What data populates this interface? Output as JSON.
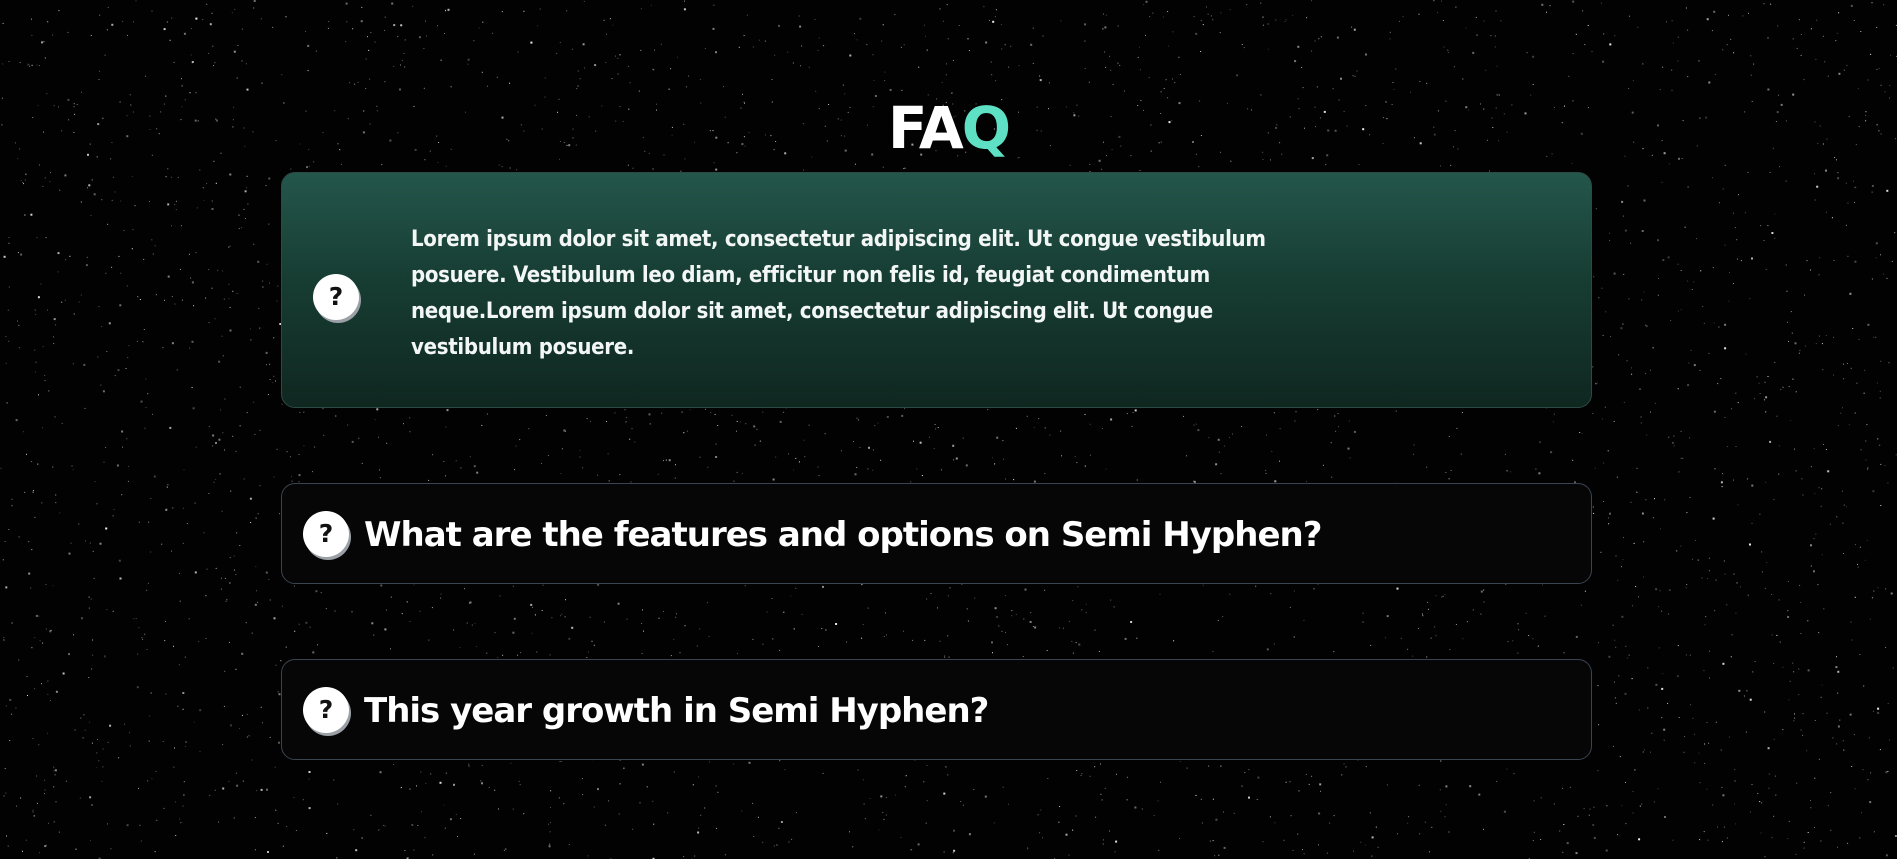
{
  "header": {
    "title_main": "FA",
    "title_accent": "Q"
  },
  "faq": {
    "items": [
      {
        "icon": "question-icon",
        "icon_glyph": "?",
        "expanded": true,
        "answer": "Lorem ipsum dolor sit amet, consectetur adipiscing elit. Ut congue vestibulum posuere. Vestibulum leo diam, efficitur non felis id, feugiat condimentum neque.Lorem ipsum dolor sit amet, consectetur adipiscing elit. Ut congue vestibulum posuere."
      },
      {
        "icon": "question-icon",
        "icon_glyph": "?",
        "expanded": false,
        "question": "What are the features and options on Semi Hyphen?"
      },
      {
        "icon": "question-icon",
        "icon_glyph": "?",
        "expanded": false,
        "question": "This year growth in Semi Hyphen?"
      }
    ]
  },
  "colors": {
    "background": "#020202",
    "accent": "#5ee0c4",
    "open_card_top": "#24564b",
    "open_card_bottom": "#0f2720",
    "closed_card": "#060606",
    "card_border": "#3a4450"
  }
}
